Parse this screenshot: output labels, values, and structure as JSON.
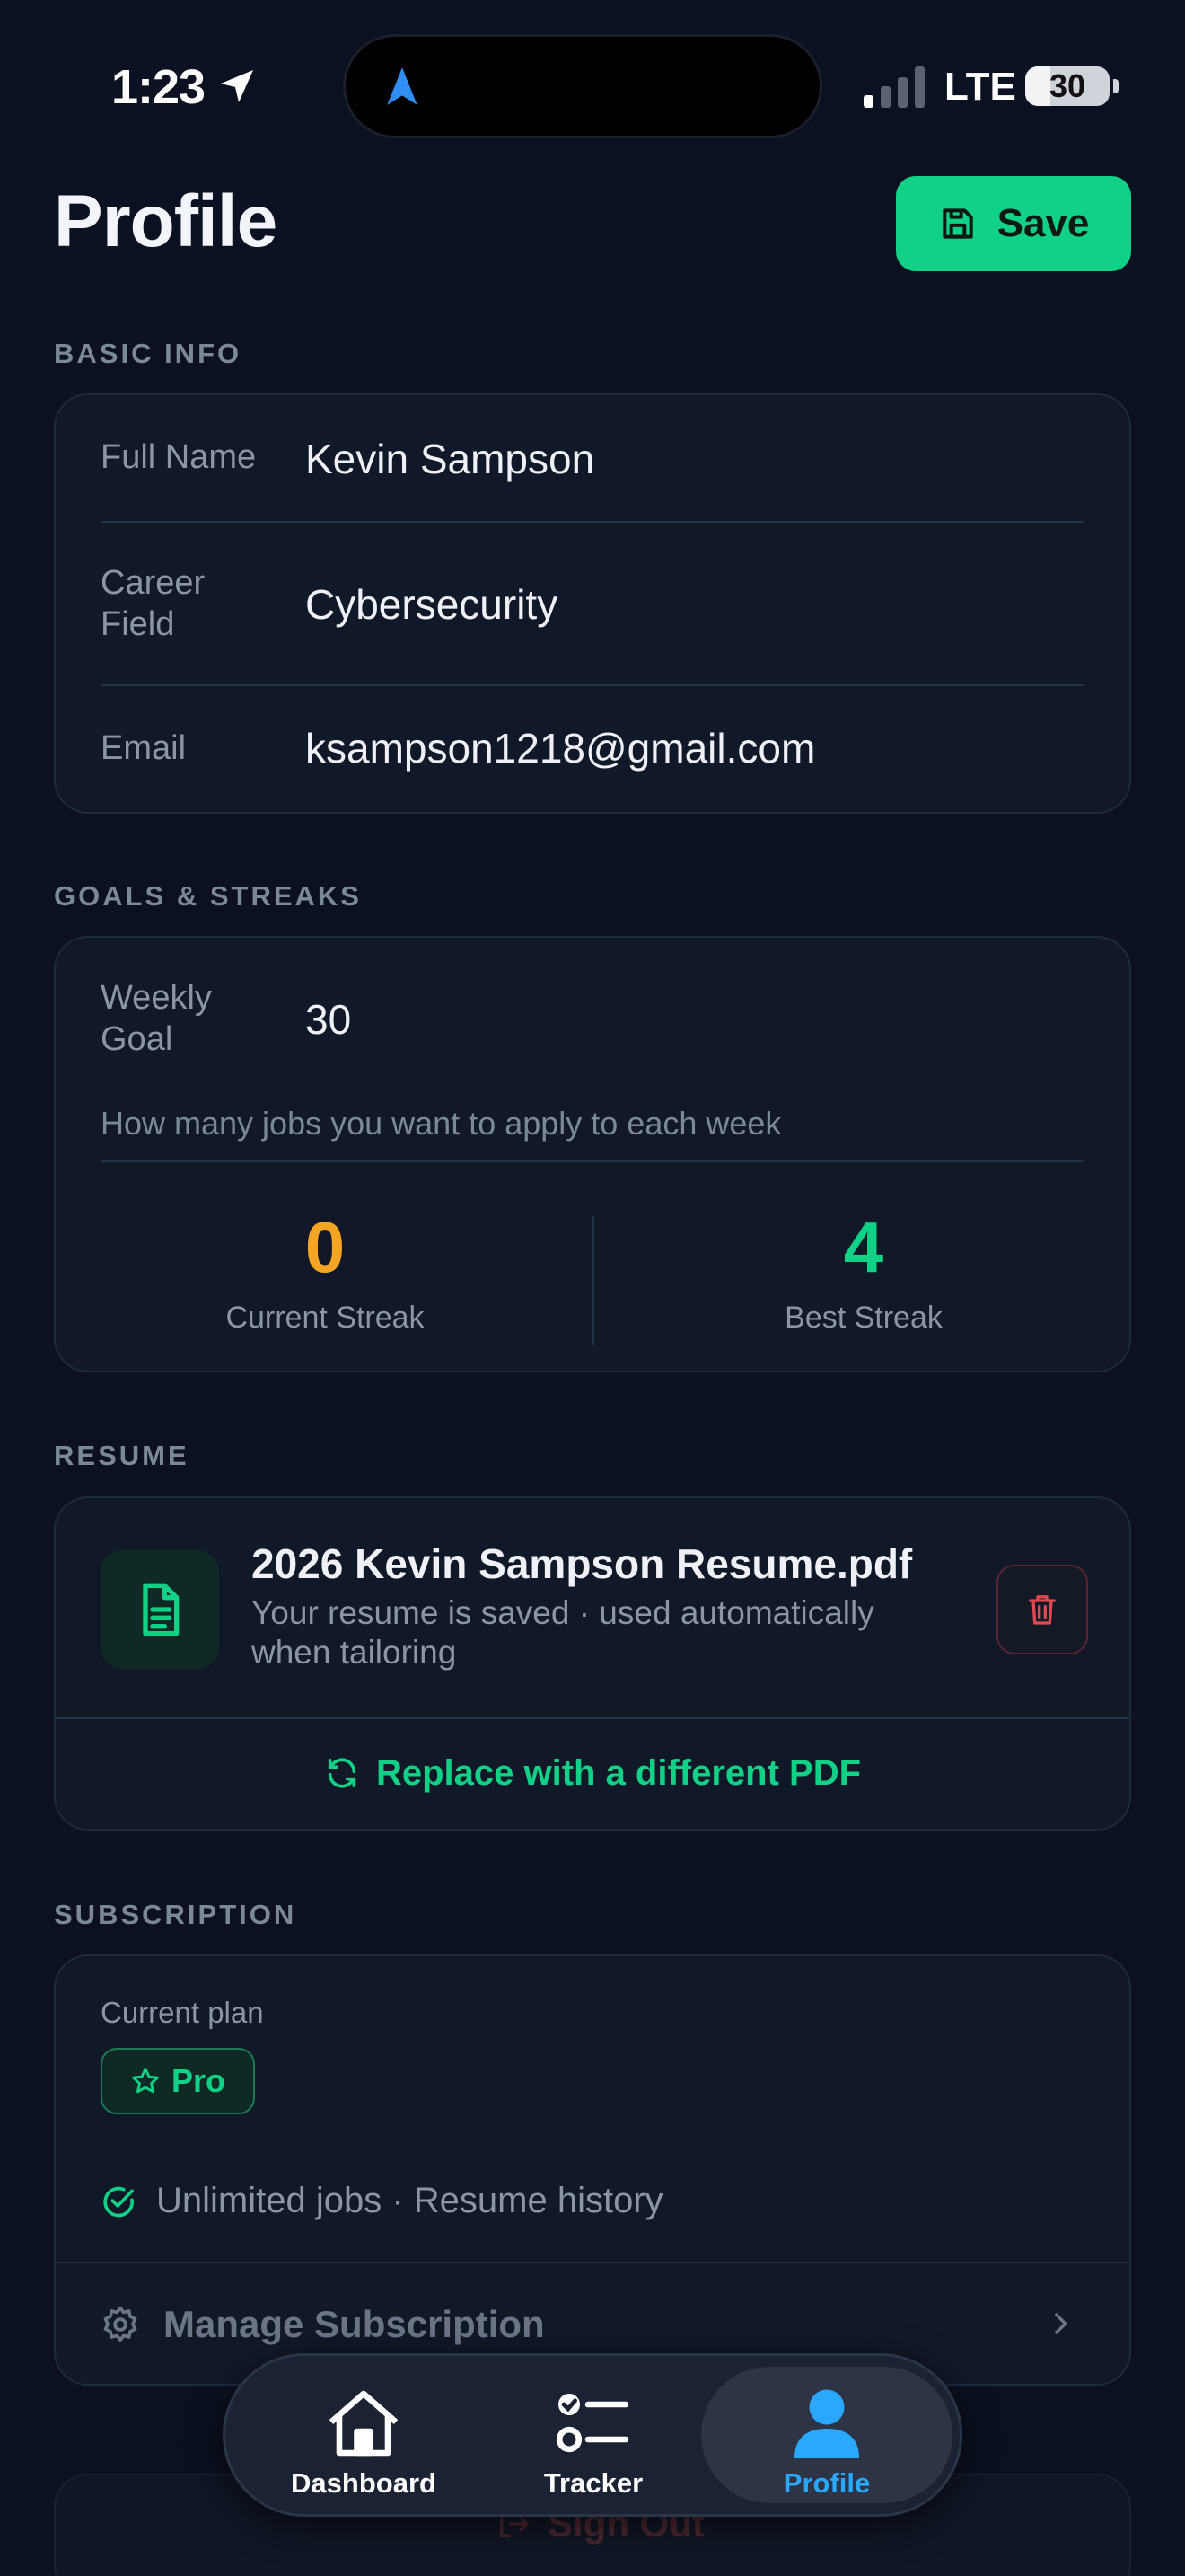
{
  "status_bar": {
    "time": "1:23",
    "network": "LTE",
    "battery_level": "30",
    "battery_fraction": 0.3
  },
  "header": {
    "title": "Profile",
    "save_label": "Save"
  },
  "basic_info": {
    "section_label": "BASIC INFO",
    "fields": [
      {
        "label": "Full Name",
        "value": "Kevin Sampson"
      },
      {
        "label": "Career Field",
        "value": "Cybersecurity"
      },
      {
        "label": "Email",
        "value": "ksampson1218@gmail.com"
      }
    ]
  },
  "goals": {
    "section_label": "GOALS & STREAKS",
    "weekly_goal_label": "Weekly Goal",
    "weekly_goal_value": "30",
    "hint": "How many jobs you want to apply to each week",
    "current_streak": {
      "value": "0",
      "label": "Current Streak",
      "color": "#f5a524"
    },
    "best_streak": {
      "value": "4",
      "label": "Best Streak",
      "color": "#10d185"
    }
  },
  "resume": {
    "section_label": "RESUME",
    "file_name": "2026 Kevin Sampson Resume.pdf",
    "description": "Your resume is saved · used automatically when tailoring",
    "replace_label": "Replace with a different PDF"
  },
  "subscription": {
    "section_label": "SUBSCRIPTION",
    "plan_label": "Current plan",
    "plan_name": "Pro",
    "features": "Unlimited jobs · Resume history",
    "manage_label": "Manage Subscription"
  },
  "sign_out_label": "Sign Out",
  "tab_bar": {
    "tabs": [
      {
        "label": "Dashboard",
        "icon": "home-icon",
        "active": false
      },
      {
        "label": "Tracker",
        "icon": "checklist-icon",
        "active": false
      },
      {
        "label": "Profile",
        "icon": "person-icon",
        "active": true
      }
    ]
  },
  "colors": {
    "accent": "#10d185",
    "active_tab": "#2aa8ff",
    "background": "#0b1120",
    "card": "#111827",
    "danger": "#e0494f"
  }
}
